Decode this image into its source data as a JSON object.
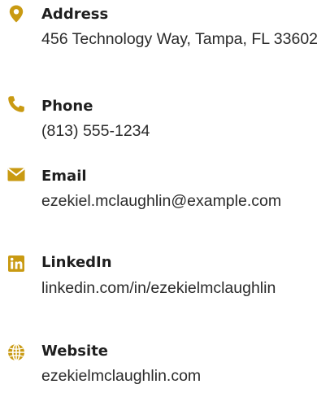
{
  "accent_color": "#c99a12",
  "contact": {
    "address": {
      "icon": "map-pin-icon",
      "label": "Address",
      "value": "456 Technology Way, Tampa, FL 33602"
    },
    "phone": {
      "icon": "phone-icon",
      "label": "Phone",
      "value": "(813) 555-1234"
    },
    "email": {
      "icon": "envelope-icon",
      "label": "Email",
      "value": "ezekiel.mclaughlin@example.com"
    },
    "linkedin": {
      "icon": "linkedin-icon",
      "label": "LinkedIn",
      "value": "linkedin.com/in/ezekielmclaughlin"
    },
    "website": {
      "icon": "globe-icon",
      "label": "Website",
      "value": "ezekielmclaughlin.com"
    }
  }
}
